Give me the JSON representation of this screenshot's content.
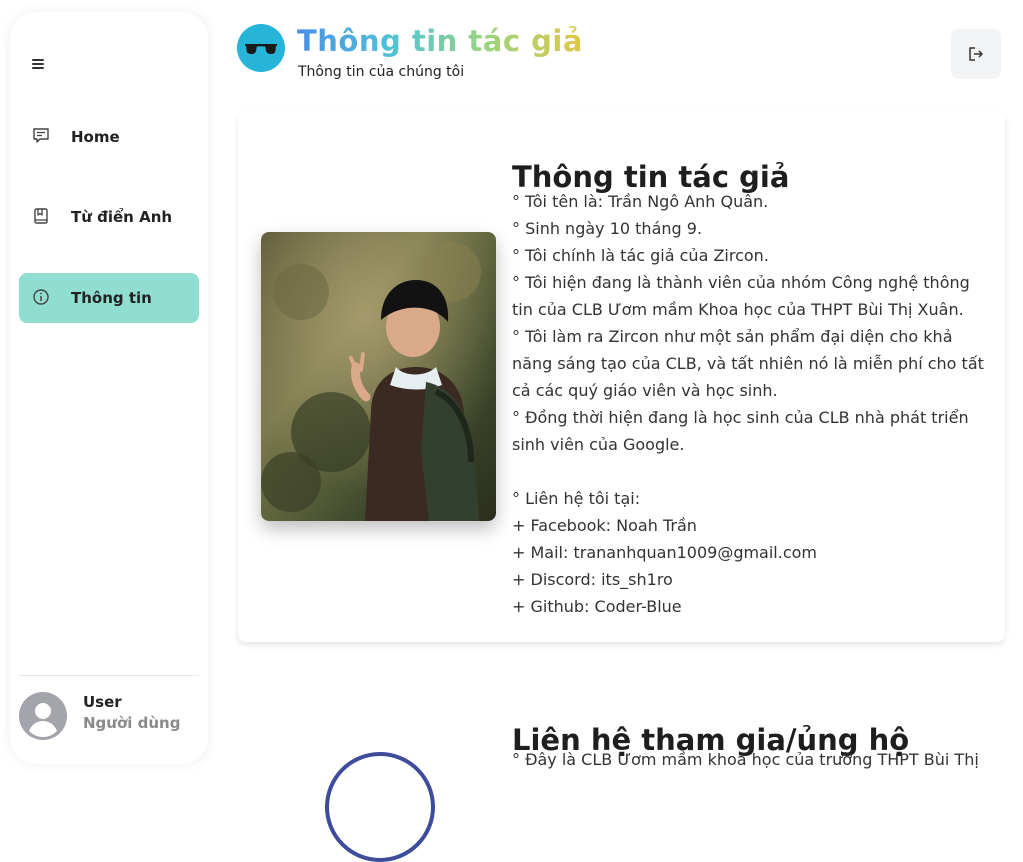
{
  "sidebar": {
    "items": [
      {
        "label": "Home",
        "icon": "message-icon"
      },
      {
        "label": "Từ điển Anh",
        "icon": "book-icon"
      },
      {
        "label": "Thông tin",
        "icon": "info-icon"
      }
    ],
    "active_item": "Thông tin",
    "active_color": "#8fded0",
    "user": {
      "name": "User",
      "role": "Người dùng"
    }
  },
  "header": {
    "title": "Thông tin tác giả",
    "subtitle": "Thông tin của chúng tôi",
    "logo_icon": "glasses-icon",
    "logout_icon": "logout-icon"
  },
  "author_card": {
    "heading": "Thông tin tác giả",
    "lines": [
      "° Tôi tên là: Trần Ngô Anh Quân.",
      "° Sinh ngày 10 tháng 9.",
      "° Tôi chính là tác giả của Zircon.",
      "° Tôi hiện đang là thành viên của nhóm Công nghệ thông tin của CLB Ươm mầm Khoa học của THPT Bùi Thị Xuân.",
      "° Tôi làm ra Zircon như một sản phẩm đại diện cho khả năng sáng tạo của CLB, và tất nhiên nó là miễn phí cho tất cả các quý giáo viên và học sinh.",
      "° Đồng thời hiện đang là học sinh của CLB nhà phát triển sinh viên của Google."
    ],
    "contact_title": "° Liên hệ tôi tại:",
    "contacts": [
      "+ Facebook: Noah Trần",
      "+ Mail: trananhquan1009@gmail.com",
      "+ Discord: its_sh1ro",
      "+ Github: Coder-Blue"
    ]
  },
  "section2": {
    "heading": "Liên hệ tham gia/ủng hộ",
    "text": "° Đây là CLB Ươm mầm khoa học của trường THPT Bùi Thị"
  },
  "colors": {
    "accent": "#8fded0",
    "logo_bg": "#26b5d8",
    "title_gradient": [
      "#4a8fe6",
      "#52c4d6",
      "#98d480",
      "#e1c74a"
    ]
  }
}
